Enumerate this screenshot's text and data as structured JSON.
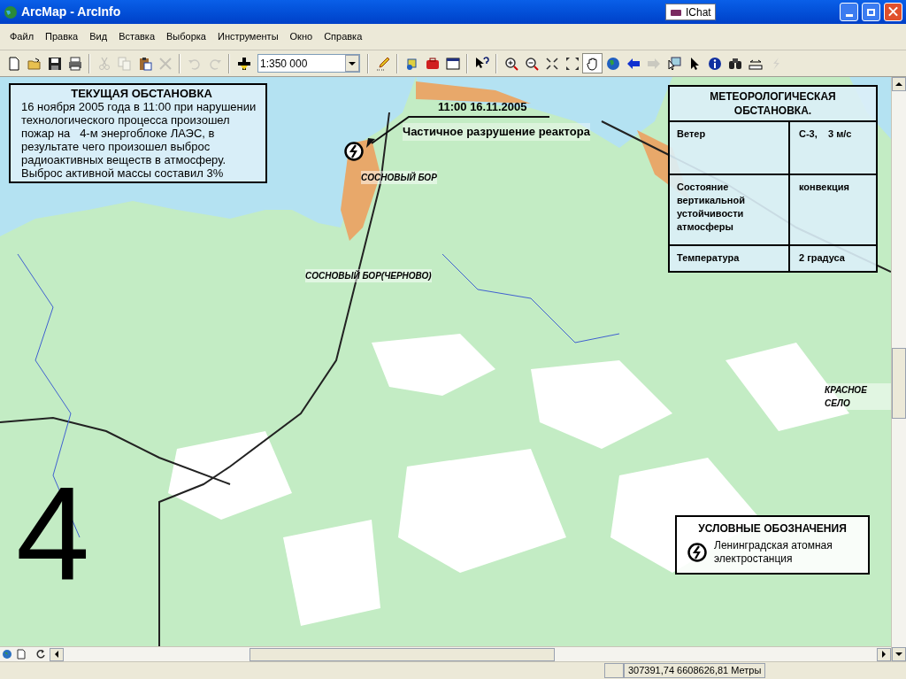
{
  "window": {
    "title": "ArcMap - ArcInfo",
    "taskbar_hint": "IChat"
  },
  "menu": [
    "Файл",
    "Правка",
    "Вид",
    "Вставка",
    "Выборка",
    "Инструменты",
    "Окно",
    "Справка"
  ],
  "toolbar": [
    {
      "kind": "button",
      "disabled": false,
      "selected": false
    },
    {
      "kind": "button",
      "disabled": false,
      "selected": false
    },
    {
      "kind": "button",
      "disabled": false,
      "selected": false
    },
    {
      "kind": "button",
      "disabled": false,
      "selected": false
    },
    {
      "kind": "separator"
    },
    {
      "kind": "button",
      "disabled": true,
      "selected": false
    },
    {
      "kind": "button",
      "disabled": true,
      "selected": false
    },
    {
      "kind": "button",
      "disabled": false,
      "selected": false
    },
    {
      "kind": "button",
      "disabled": true,
      "selected": false
    },
    {
      "kind": "separator"
    },
    {
      "kind": "button",
      "disabled": true,
      "selected": false
    },
    {
      "kind": "button",
      "disabled": true,
      "selected": false
    },
    {
      "kind": "separator"
    },
    {
      "kind": "button",
      "disabled": false,
      "selected": false
    },
    {
      "kind": "scale",
      "value": "1:350 000"
    },
    {
      "kind": "separator"
    },
    {
      "kind": "button",
      "disabled": false,
      "selected": false
    },
    {
      "kind": "separator"
    },
    {
      "kind": "button",
      "disabled": false,
      "selected": false
    },
    {
      "kind": "button",
      "disabled": false,
      "selected": false
    },
    {
      "kind": "button",
      "disabled": false,
      "selected": false
    },
    {
      "kind": "separator"
    },
    {
      "kind": "button",
      "disabled": false,
      "selected": false
    },
    {
      "kind": "separator"
    },
    {
      "kind": "button",
      "disabled": false,
      "selected": false
    },
    {
      "kind": "button",
      "disabled": false,
      "selected": false
    },
    {
      "kind": "button",
      "disabled": false,
      "selected": false
    },
    {
      "kind": "button",
      "disabled": false,
      "selected": false
    },
    {
      "kind": "button",
      "disabled": false,
      "selected": true
    },
    {
      "kind": "button",
      "disabled": false,
      "selected": false
    },
    {
      "kind": "button",
      "disabled": false,
      "selected": false
    },
    {
      "kind": "button",
      "disabled": true,
      "selected": false
    },
    {
      "kind": "button",
      "disabled": false,
      "selected": false
    },
    {
      "kind": "button",
      "disabled": false,
      "selected": false
    },
    {
      "kind": "button",
      "disabled": false,
      "selected": false
    },
    {
      "kind": "button",
      "disabled": false,
      "selected": false
    },
    {
      "kind": "button",
      "disabled": false,
      "selected": false
    },
    {
      "kind": "button",
      "disabled": true,
      "selected": false
    }
  ],
  "map": {
    "situation": {
      "title": "ТЕКУЩАЯ ОБСТАНОВКА",
      "text": "16 ноября 2005 года в 11:00 при нарушении технологического процесса произошел пожар на   4-м энергоблоке ЛАЭС, в результате чего произошел выброс радиоактивных веществ в атмосферу. Выброс активной массы составил 3%"
    },
    "annotation": {
      "time": "11:00 16.11.2005",
      "event": "Частичное разрушение реактора"
    },
    "labels": [
      "СОСНОВЫЙ БОР",
      "СОСНОВЫЙ БОР(ЧЕРНОВО)",
      "КРАСНОЕ СЕЛО"
    ],
    "weather": {
      "title": "МЕТЕОРОЛОГИЧЕСКАЯ ОБСТАНОВКА.",
      "rows": [
        {
          "name": "Ветер",
          "value": "С-3,    3 м/с"
        },
        {
          "name": "Состояние вертикальной устойчивости атмосферы",
          "value": "конвекция"
        },
        {
          "name": "Температура",
          "value": "2 градуса"
        }
      ]
    },
    "legend": {
      "title": "УСЛОВНЫЕ ОБОЗНАЧЕНИЯ",
      "items": [
        {
          "label": "Ленинградская атомная электростанция"
        }
      ]
    },
    "slide_number": "4"
  },
  "status_bar": {
    "coordinates": "307391,74  6608626,81 Метры"
  }
}
